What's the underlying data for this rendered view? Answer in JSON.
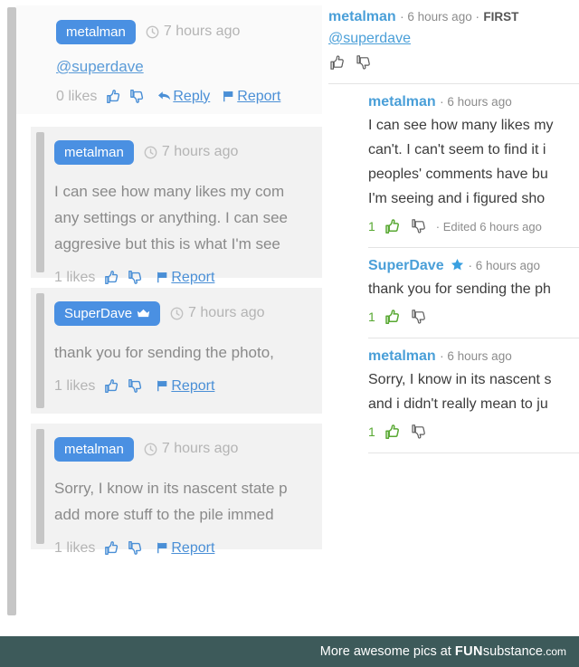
{
  "left_panel": {
    "root_comment": {
      "username": "metalman",
      "badge_icon": "none",
      "timestamp": "7 hours ago",
      "clock_icon": "clock-icon",
      "mention": "@superdave",
      "likes": "0 likes",
      "like_icon": "thumbs-up-icon",
      "dislike_icon": "thumbs-down-icon",
      "reply_icon": "reply-arrow-icon",
      "reply_label": "Reply",
      "report_icon": "flag-icon",
      "report_label": "Report"
    },
    "replies": [
      {
        "username": "metalman",
        "badge_icon": "none",
        "timestamp": "7 hours ago",
        "clock_icon": "clock-icon",
        "body_lines": [
          "I can see how many likes my com",
          "any settings or anything. I can see",
          "aggresive but this is what I'm see"
        ],
        "likes": "1 likes",
        "like_icon": "thumbs-up-icon",
        "dislike_icon": "thumbs-down-icon",
        "report_icon": "flag-icon",
        "report_label": "Report"
      },
      {
        "username": "SuperDave",
        "badge_icon": "crown-icon",
        "timestamp": "7 hours ago",
        "clock_icon": "clock-icon",
        "body_lines": [
          "thank you for sending the photo, "
        ],
        "likes": "1 likes",
        "like_icon": "thumbs-up-icon",
        "dislike_icon": "thumbs-down-icon",
        "report_icon": "flag-icon",
        "report_label": "Report"
      },
      {
        "username": "metalman",
        "badge_icon": "none",
        "timestamp": "7 hours ago",
        "clock_icon": "clock-icon",
        "body_lines": [
          "Sorry, I know in its nascent state p",
          "add more stuff to the pile immed"
        ],
        "likes": "1 likes",
        "like_icon": "thumbs-up-icon",
        "dislike_icon": "thumbs-down-icon",
        "report_icon": "flag-icon",
        "report_label": "Report"
      }
    ]
  },
  "right_panel": {
    "root_comment": {
      "username": "metalman",
      "badge_icon": "none",
      "meta": "· 6 hours ago ·",
      "first_badge": "FIRST",
      "mention": "@superdave",
      "like_icon": "thumbs-up-icon",
      "dislike_icon": "thumbs-down-icon"
    },
    "replies": [
      {
        "username": "metalman",
        "badge_icon": "none",
        "meta": "· 6 hours ago",
        "body_lines": [
          "I can see how many likes my",
          "can't. I can't seem to find it i",
          "peoples' comments have bu",
          "I'm seeing and i figured sho"
        ],
        "like_count": "1",
        "like_icon": "thumbs-up-icon",
        "dislike_icon": "thumbs-down-icon",
        "edited": "· Edited 6 hours ago"
      },
      {
        "username": "SuperDave",
        "badge_icon": "star-icon",
        "meta": "· 6 hours ago",
        "body_lines": [
          "thank you for sending the ph"
        ],
        "like_count": "1",
        "like_icon": "thumbs-up-icon",
        "dislike_icon": "thumbs-down-icon",
        "edited": ""
      },
      {
        "username": "metalman",
        "badge_icon": "none",
        "meta": "· 6 hours ago",
        "body_lines": [
          "Sorry, I know in its nascent s",
          "and i didn't really mean to ju"
        ],
        "like_count": "1",
        "like_icon": "thumbs-up-icon",
        "dislike_icon": "thumbs-down-icon",
        "edited": ""
      }
    ]
  },
  "footer": {
    "prefix": "More awesome pics at ",
    "brand_bold": "FUN",
    "brand_rest": "substance",
    "tld": ".com"
  },
  "colors": {
    "badge_blue": "#4a90e2",
    "link_blue": "#4a8fd6",
    "name_blue": "#4a9fd8",
    "like_green": "#58a832",
    "muted_gray": "#b4b4b4",
    "body_gray": "#8a8a8a",
    "footer_teal": "#3d5a5a"
  }
}
